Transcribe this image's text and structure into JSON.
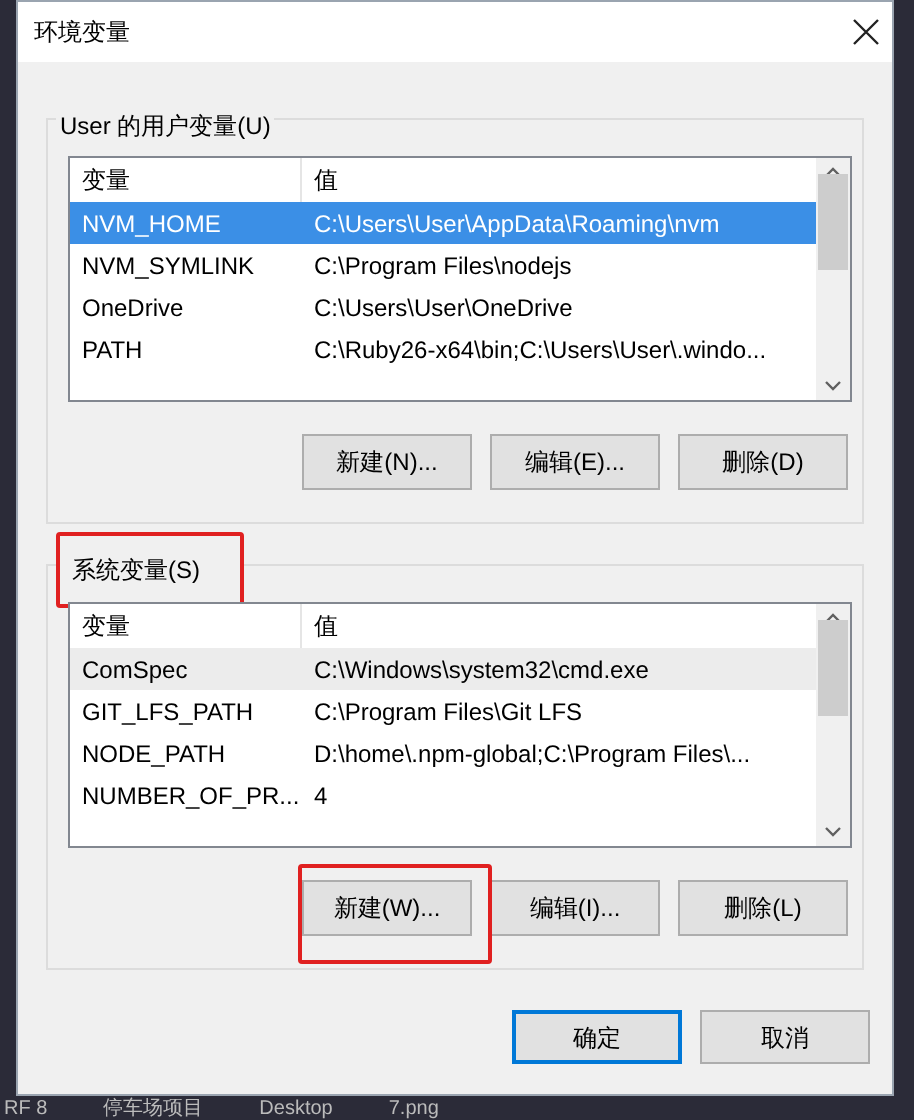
{
  "window": {
    "title": "环境变量"
  },
  "user_vars": {
    "label": "User 的用户变量(U)",
    "columns": [
      "变量",
      "值"
    ],
    "rows": [
      {
        "name": "NVM_HOME",
        "value": "C:\\Users\\User\\AppData\\Roaming\\nvm",
        "selected": true
      },
      {
        "name": "NVM_SYMLINK",
        "value": "C:\\Program Files\\nodejs",
        "selected": false
      },
      {
        "name": "OneDrive",
        "value": "C:\\Users\\User\\OneDrive",
        "selected": false
      },
      {
        "name": "PATH",
        "value": "C:\\Ruby26-x64\\bin;C:\\Users\\User\\.windo...",
        "selected": false
      }
    ],
    "buttons": [
      "新建(N)...",
      "编辑(E)...",
      "删除(D)"
    ]
  },
  "system_vars": {
    "label": "系统变量(S)",
    "annotated": true,
    "columns": [
      "变量",
      "值"
    ],
    "rows": [
      {
        "name": "ComSpec",
        "value": "C:\\Windows\\system32\\cmd.exe",
        "selected": false,
        "highlighted": true
      },
      {
        "name": "GIT_LFS_PATH",
        "value": "C:\\Program Files\\Git LFS",
        "selected": false,
        "highlighted": false
      },
      {
        "name": "NODE_PATH",
        "value": "D:\\home\\.npm-global;C:\\Program Files\\...",
        "selected": false,
        "highlighted": false
      },
      {
        "name": "NUMBER_OF_PR...",
        "value": "4",
        "selected": false,
        "highlighted": false
      }
    ],
    "buttons": [
      {
        "label": "新建(W)...",
        "annotated": true
      },
      {
        "label": "编辑(I)...",
        "annotated": false
      },
      {
        "label": "删除(L)",
        "annotated": false
      }
    ]
  },
  "dialog_buttons": [
    {
      "label": "确定",
      "default": true
    },
    {
      "label": "取消",
      "default": false
    }
  ],
  "taskbar": [
    "RF 8",
    "停车场项目",
    "Desktop",
    "7.png"
  ]
}
